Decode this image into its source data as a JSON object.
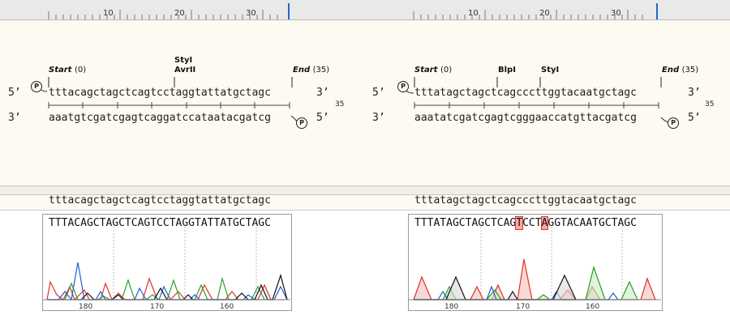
{
  "left": {
    "ruler": {
      "ticks": [
        "10",
        "20",
        "30"
      ]
    },
    "sites": {
      "start": "Start",
      "start_pos": "(0)",
      "enzyme1": "StyI",
      "enzyme2": "AvrII",
      "end": "End",
      "end_pos": "(35)"
    },
    "top_strand": {
      "five": "5’",
      "seq": "tttacagctagctcagtcctaggtattatgctagc",
      "three": "3’"
    },
    "bottom_strand": {
      "three": "3’",
      "seq": "aaatgtcgatcgagtcaggatccataatacgatcg",
      "five": "5’"
    },
    "length": "35",
    "phospho": "P",
    "reference": "tttacagctagctcagtcctaggtattatgctagc",
    "read": "TTTACAGCTAGCTCAGTCCTAGGTATTATGCTAGC",
    "axis": [
      "180",
      "170",
      "160"
    ]
  },
  "right": {
    "ruler": {
      "ticks": [
        "10",
        "20",
        "30"
      ]
    },
    "sites": {
      "start": "Start",
      "start_pos": "(0)",
      "enzyme1": "BlpI",
      "enzyme2": "StyI",
      "end": "End",
      "end_pos": "(35)"
    },
    "top_strand": {
      "five": "5’",
      "seq": "tttatagctagctcagcccttggtacaatgctagc",
      "three": "3’"
    },
    "bottom_strand": {
      "three": "3’",
      "seq": "aaatatcgatcgagtcgggaaccatgttacgatcg",
      "five": "5’"
    },
    "length": "35",
    "phospho": "P",
    "reference": "tttatagctagctcagcccttggtacaatgctagc",
    "read_parts": [
      "TTTATAGCTAGCTCAG",
      "T",
      "CCT",
      "A",
      "GGTACAATGCTAGC"
    ],
    "axis": [
      "180",
      "170",
      "160"
    ]
  },
  "colors": {
    "A": "#2ca02c",
    "C": "#1f5fd6",
    "G": "#111111",
    "T": "#e0302a",
    "mismatch": "#f4a7a7",
    "highlight": "#2266cc"
  }
}
